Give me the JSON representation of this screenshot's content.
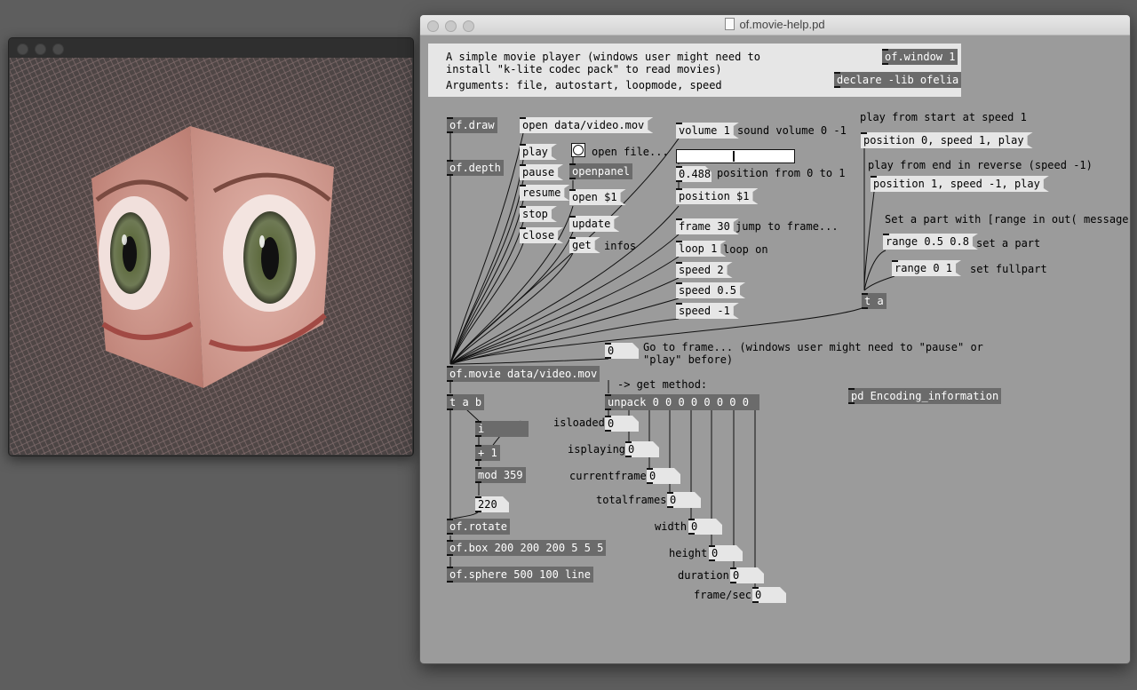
{
  "render_window": {
    "title": ""
  },
  "patch_window": {
    "title": "of.movie-help.pd"
  },
  "info": {
    "line1": "A simple movie player (windows user might need to",
    "line2": "install \"k-lite codec pack\" to read movies)",
    "line3": "Arguments: file, autostart, loopmode, speed"
  },
  "objects": {
    "of_window": "of.window 1",
    "declare": "declare -lib ofelia",
    "of_draw": "of.draw",
    "of_depth": "of.depth",
    "of_movie": "of.movie data/video.mov",
    "t_a_b": "t a b",
    "i": "i",
    "plus1": "+ 1",
    "mod359": "mod 359",
    "of_rotate": "of.rotate",
    "of_box": "of.box 200 200 200 5 5 5",
    "of_sphere": "of.sphere 500 100 line",
    "openpanel": "openpanel",
    "unpack": "unpack 0 0 0 0 0 0 0 0",
    "t_a": "t a",
    "pd_encoding": "pd Encoding_information"
  },
  "messages": {
    "open_file": "open data/video.mov",
    "play": "play",
    "pause": "pause",
    "resume": "resume",
    "stop": "stop",
    "close": "close",
    "open_s1": "open $1",
    "update": "update",
    "get": "get",
    "volume": "volume 1",
    "position_s1": "position $1",
    "frame30": "frame 30",
    "loop1": "loop 1",
    "speed2": "speed 2",
    "speed05": "speed 0.5",
    "speedm1": "speed -1",
    "pos_fwd": "position 0, speed 1, play",
    "pos_rev": "position 1, speed -1, play",
    "range_part": "range 0.5 0.8",
    "range_full": "range 0 1"
  },
  "numbers": {
    "position_value": "0.488",
    "counter": "220",
    "goto_frame": "0",
    "isloaded": "0",
    "isplaying": "0",
    "currentframe": "0",
    "totalframes": "0",
    "width": "0",
    "height": "0",
    "duration": "0",
    "framesec": "0"
  },
  "slider": {
    "value_fraction": 0.488
  },
  "comments": {
    "open_file_label": "open file...",
    "infos": "infos",
    "sound_volume": "sound volume 0 -1",
    "position_range": "position from 0 to 1",
    "jump_frame": "jump to frame...",
    "loop_on": "loop on",
    "play_start": "play from start at speed 1",
    "play_end": "play from end in reverse (speed -1)",
    "set_part_header": "Set a part with [range in out( message:",
    "set_part": "set a part",
    "set_fullpart": "set fullpart",
    "goto_line1": "Go to frame... (windows user might need to \"pause\" or",
    "goto_line2": "\"play\" before)",
    "get_method": "-> get method:",
    "isloaded": "isloaded",
    "isplaying": "isplaying",
    "currentframe": "currentframe",
    "totalframes": "totalframes",
    "width": "width",
    "height": "height",
    "duration": "duration",
    "framesec": "frame/sec"
  }
}
